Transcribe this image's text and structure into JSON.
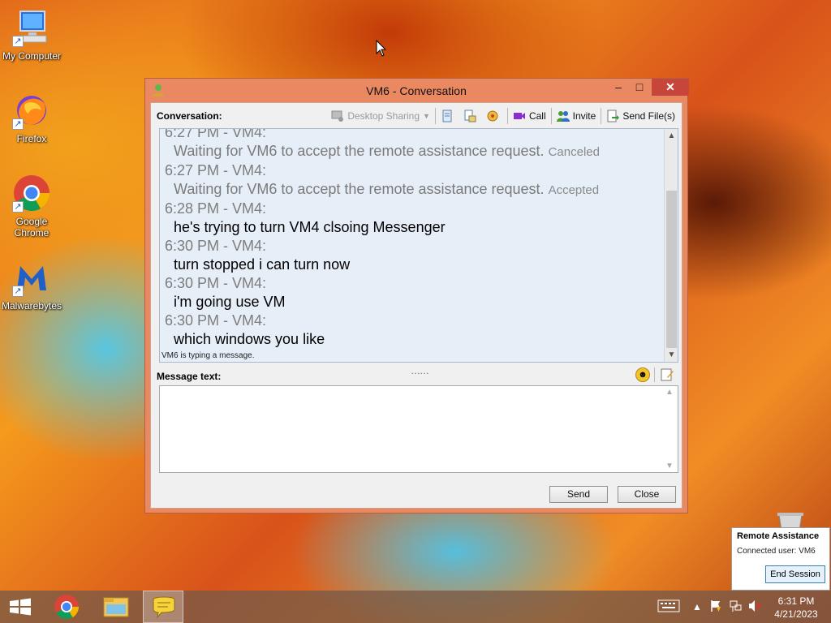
{
  "desktop": {
    "icons": [
      {
        "label": "My Computer"
      },
      {
        "label": "Firefox"
      },
      {
        "label": "Google Chrome"
      },
      {
        "label": "Malwarebytes"
      }
    ],
    "recycle_label": "Recycle Bin"
  },
  "window": {
    "title": "VM6 - Conversation",
    "controls": {
      "minimize": "–",
      "maximize": "□",
      "close": "✕"
    },
    "conversation_label": "Conversation:",
    "toolbar": {
      "desktop_sharing": "Desktop Sharing",
      "call": "Call",
      "invite": "Invite",
      "send_files": "Send File(s)"
    },
    "messages": [
      {
        "header": "6:27 PM - VM4:",
        "text": "Waiting for VM6 to accept the remote assistance request.",
        "status": "Canceled",
        "system": true
      },
      {
        "header": "6:27 PM - VM4:",
        "text": "Waiting for VM6 to accept the remote assistance request.",
        "status": "Accepted",
        "system": true
      },
      {
        "header": "6:28 PM - VM4:",
        "text": "he's trying to turn VM4 clsoing Messenger",
        "status": "",
        "system": false
      },
      {
        "header": "6:30 PM - VM4:",
        "text": "turn stopped i can turn now",
        "status": "",
        "system": false
      },
      {
        "header": "6:30 PM - VM4:",
        "text": "i'm going use VM",
        "status": "",
        "system": false
      },
      {
        "header": "6:30 PM - VM4:",
        "text": "which windows you like",
        "status": "",
        "system": false
      }
    ],
    "typing_status": "VM6 is typing a message.",
    "splitter_grip": "……",
    "message_text_label": "Message text:",
    "message_input_value": "",
    "send_label": "Send",
    "close_label": "Close"
  },
  "remote_assistance": {
    "title": "Remote Assistance",
    "connected_user": "Connected user:  VM6",
    "end_session": "End Session"
  },
  "taskbar": {
    "time": "6:31 PM",
    "date": "4/21/2023"
  },
  "colors": {
    "window_frame": "#e98861",
    "close_button": "#c7463c",
    "history_bg": "#e6eef8"
  }
}
